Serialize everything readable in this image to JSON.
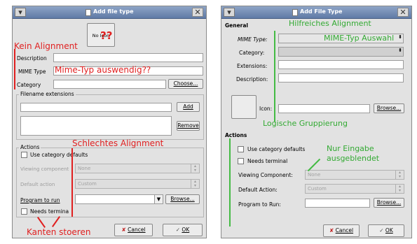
{
  "left": {
    "title": "Add file type",
    "icon_button_label": "No Icon",
    "labels": {
      "description": "Description",
      "mime_type": "MIME Type",
      "category": "Category",
      "choose": "Choose...",
      "filename_extensions": "Filename extensions",
      "add": "Add",
      "remove": "Remove",
      "actions": "Actions",
      "use_category_defaults": "Use category defaults",
      "viewing_component": "Viewing component",
      "viewing_component_value": "None",
      "default_action": "Default action",
      "default_action_value": "Custom",
      "program_to_run": "Program to run",
      "browse": "Browse...",
      "needs_terminal": "Needs termina",
      "cancel": "Cancel",
      "ok": "OK"
    },
    "annotations": {
      "qq": "??",
      "kein_alignment": "Kein Alignment",
      "mime_typ": "Mime-Typ auswendig??",
      "schlechtes": "Schlechtes Alignment",
      "kanten": "Kanten stoeren"
    }
  },
  "right": {
    "title": "Add File Type",
    "labels": {
      "general": "General",
      "mime_type": "MIME Type:",
      "category": "Category:",
      "extensions": "Extensions:",
      "description": "Description:",
      "icon": "Icon:",
      "browse_icon": "Browse...",
      "actions": "Actions",
      "use_category_defaults": "Use category defaults",
      "needs_terminal": "Needs terminal",
      "viewing_component": "Viewing Component:",
      "viewing_component_value": "None",
      "default_action": "Default Action:",
      "default_action_value": "Custom",
      "program_to_run": "Program to Run:",
      "browse_program": "Browse...",
      "cancel": "Cancel",
      "ok": "OK"
    },
    "annotations": {
      "hilfreiches": "Hilfreiches Alignment",
      "mime_auswahl": "MIME-Typ Auswahl",
      "logische": "Logische Gruppierung",
      "nur_eingabe_1": "Nur Eingabe",
      "nur_eingabe_2": "ausgeblendet"
    }
  },
  "colors": {
    "annotation_red": "#e02020",
    "annotation_green": "#33aa33",
    "titlebar": "#6f88b2"
  }
}
